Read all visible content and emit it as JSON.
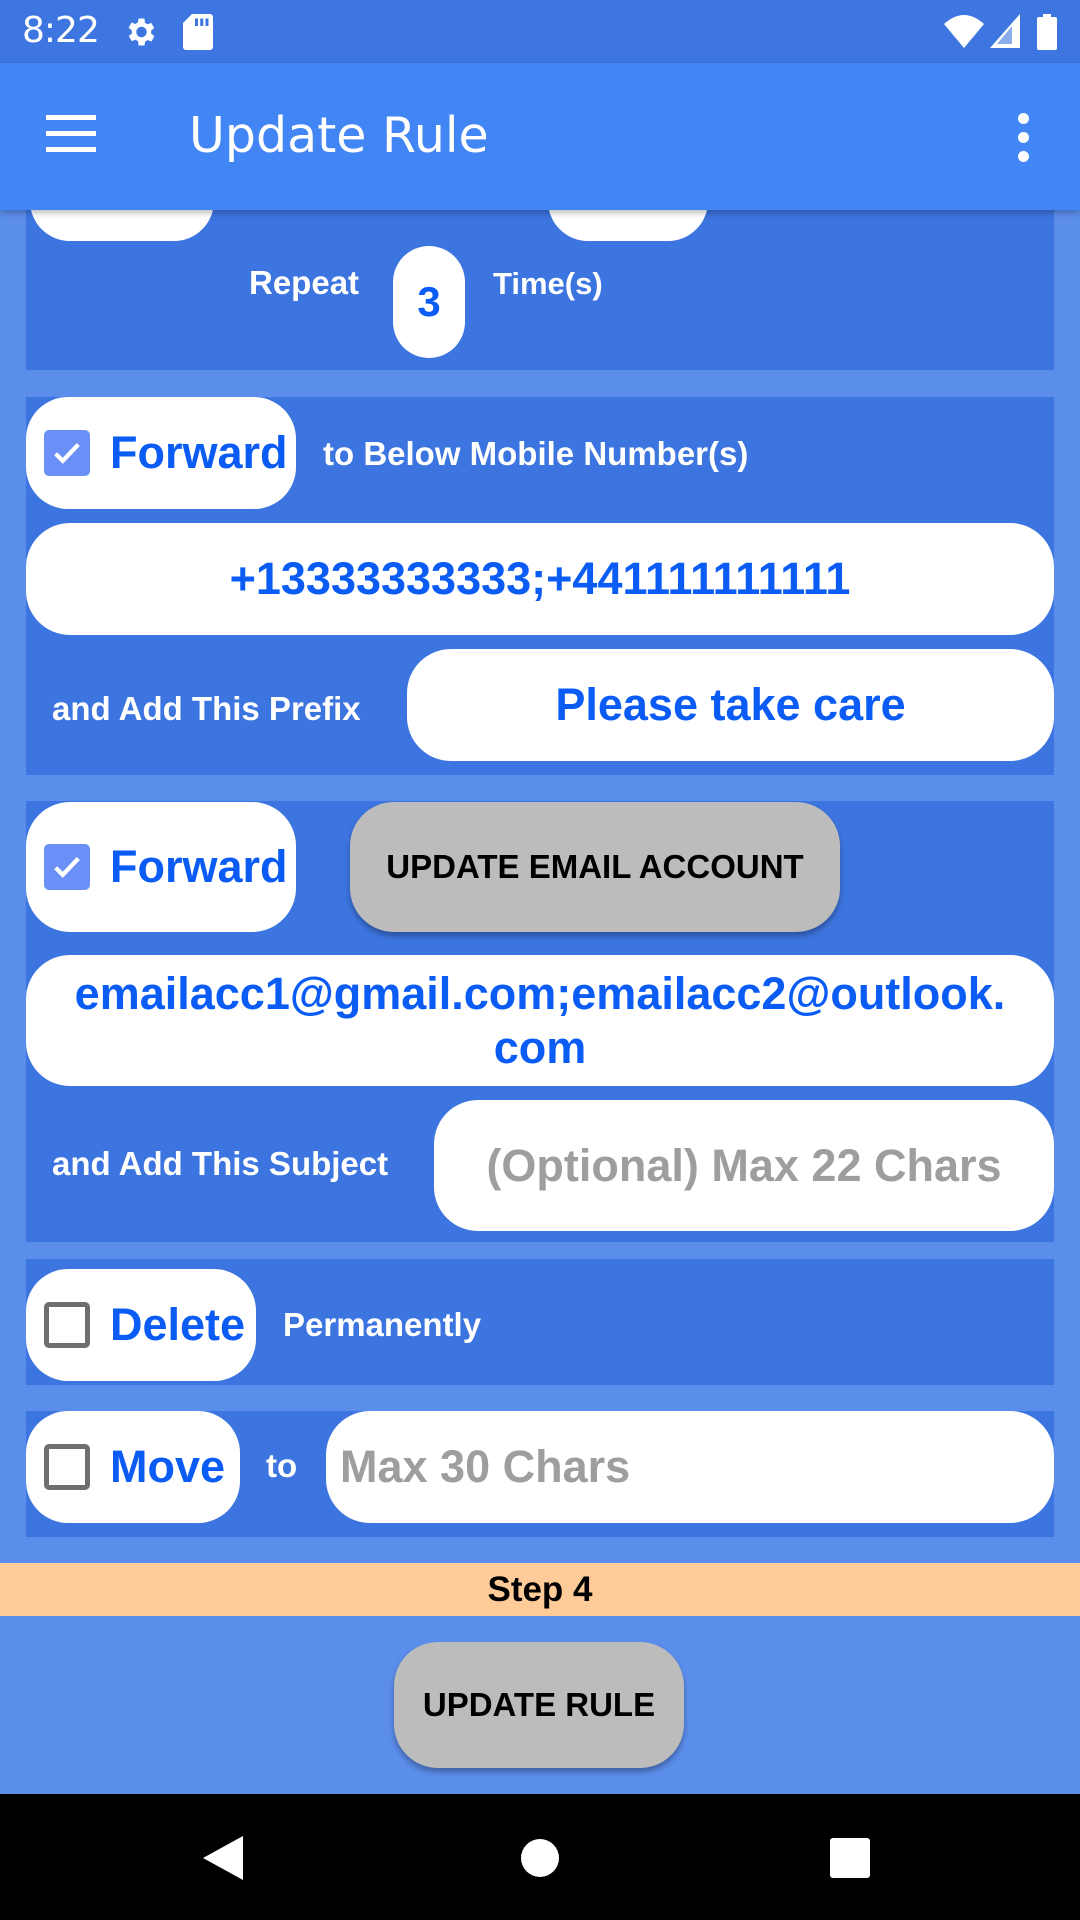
{
  "status_bar": {
    "time": "8:22",
    "left_icons": [
      "settings-icon",
      "sd-card-icon"
    ],
    "right_icons": [
      "wifi-icon",
      "cell-signal-icon",
      "battery-icon"
    ]
  },
  "app_bar": {
    "title": "Update Rule",
    "menu_icon": "hamburger-menu-icon",
    "overflow_icon": "more-vert-icon"
  },
  "repeat_section": {
    "label_before": "Repeat",
    "value": "3",
    "label_after": "Time(s)"
  },
  "forward_sms_section": {
    "checkbox_label": "Forward",
    "checked": true,
    "description": "to Below Mobile Number(s)",
    "numbers_value": "+13333333333;+441111111111",
    "prefix_label": "and Add This Prefix",
    "prefix_value": "Please take care"
  },
  "forward_email_section": {
    "checkbox_label": "Forward",
    "checked": true,
    "update_email_button": "UPDATE EMAIL ACCOUNT",
    "emails_value": "emailacc1@gmail.com;emailacc2@outlook.com",
    "subject_label": "and Add This Subject",
    "subject_placeholder": "(Optional) Max 22 Chars"
  },
  "delete_section": {
    "checkbox_label": "Delete",
    "checked": false,
    "description": "Permanently"
  },
  "move_section": {
    "checkbox_label": "Move",
    "checked": false,
    "to_label": "to",
    "folder_placeholder": "Max 30 Chars"
  },
  "step": {
    "label": "Step 4"
  },
  "update_rule_button": "UPDATE RULE",
  "colors": {
    "status_bar": "#3d76e0",
    "app_bar": "#4285f4",
    "background": "#5b8deb",
    "panel": "#3d75e0",
    "accent_text": "#0a5cf5",
    "step_bar": "#ffcc99",
    "button_gray": "#bcbcbc"
  }
}
